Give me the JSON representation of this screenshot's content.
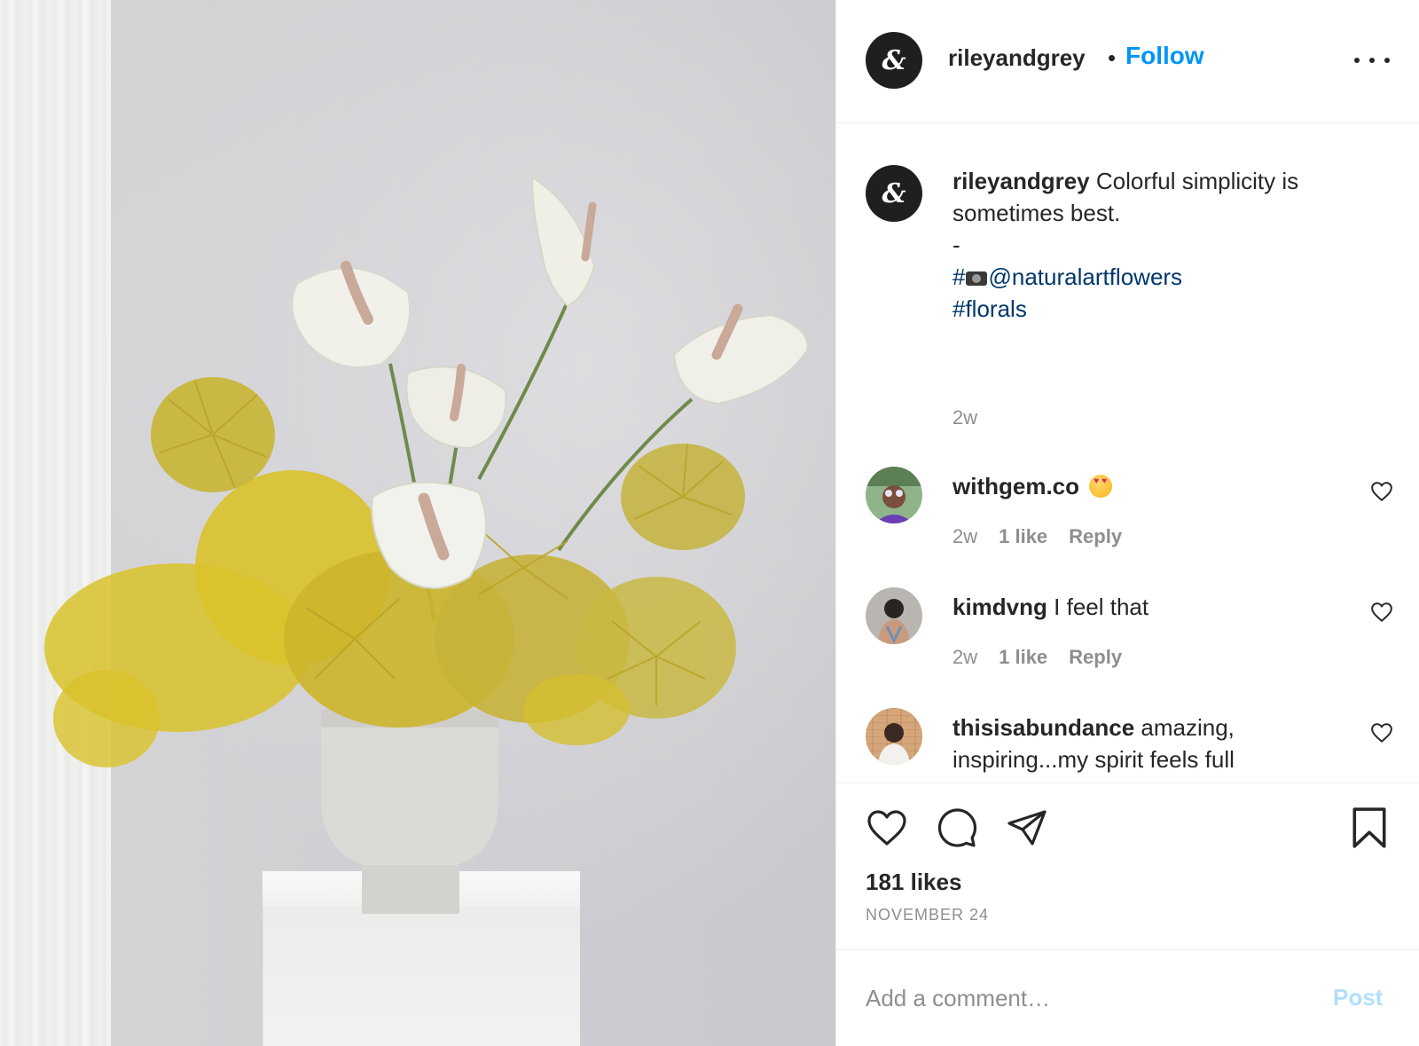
{
  "post": {
    "image_alt": "",
    "author": {
      "username": "rileyandgrey",
      "avatar_glyph": "&",
      "avatar_icon": "ampersand-logo-icon"
    },
    "header": {
      "separator": "•",
      "follow_label": "Follow",
      "more_icon": "more-options-icon"
    },
    "caption": {
      "username": "rileyandgrey",
      "text": "Colorful simplicity is sometimes best.",
      "dash": "-",
      "photo_credit_prefix": "#",
      "photo_credit_icon": "camera-emoji-icon",
      "photo_credit_handle": "@naturalartflowers",
      "hashtag": "#florals",
      "time": "2w"
    },
    "comments": [
      {
        "username": "withgem.co",
        "text": "",
        "emoji_icon": "heart-eyes-emoji-icon",
        "time": "2w",
        "likes": "1 like",
        "reply_label": "Reply",
        "like_icon": "heart-outline-icon"
      },
      {
        "username": "kimdvng",
        "text": "I feel that",
        "time": "2w",
        "likes": "1 like",
        "reply_label": "Reply",
        "like_icon": "heart-outline-icon"
      },
      {
        "username": "thisisabundance",
        "text": "amazing, inspiring...my spirit feels full",
        "like_icon": "heart-outline-icon"
      }
    ],
    "actions": {
      "like_icon": "heart-icon",
      "comment_icon": "comment-bubble-icon",
      "share_icon": "paper-plane-icon",
      "save_icon": "bookmark-icon"
    },
    "likes_count": "181 likes",
    "date": "NOVEMBER 24",
    "add_comment": {
      "placeholder": "Add a comment…",
      "post_label": "Post"
    },
    "colors": {
      "link_blue": "#0095f6",
      "hashtag_navy": "#00376b",
      "muted_gray": "#8e8e8e",
      "post_disabled": "#b2dffc"
    }
  }
}
